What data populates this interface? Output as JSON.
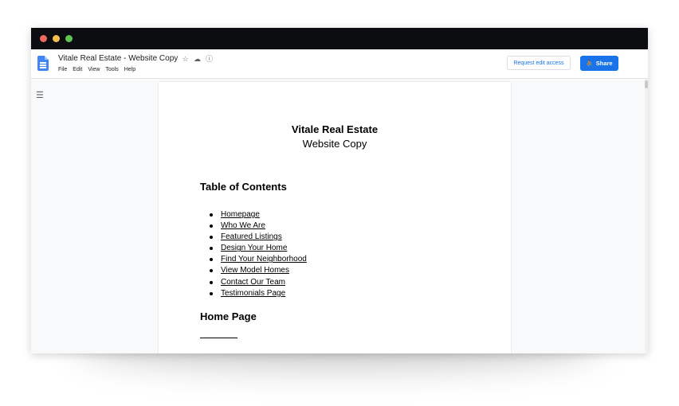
{
  "app": {
    "doc_title": "Vitale Real Estate - Website Copy",
    "menu": [
      "File",
      "Edit",
      "View",
      "Tools",
      "Help"
    ],
    "title_icons": [
      "star-icon",
      "cloud-drive-icon",
      "info-icon"
    ],
    "request_edit_label": "Request edit access",
    "share_label": "Share",
    "accent": "#1a73e8"
  },
  "document": {
    "title": "Vitale Real Estate",
    "subtitle": "Website Copy",
    "toc_heading": "Table of Contents",
    "toc": [
      "Homepage",
      "Who We Are",
      "Featured Listings",
      "Design Your Home",
      "Find Your Neighborhood",
      "View Model Homes",
      "Contact Our Team",
      "Testimonials Page"
    ],
    "section_heading": "Home Page"
  }
}
